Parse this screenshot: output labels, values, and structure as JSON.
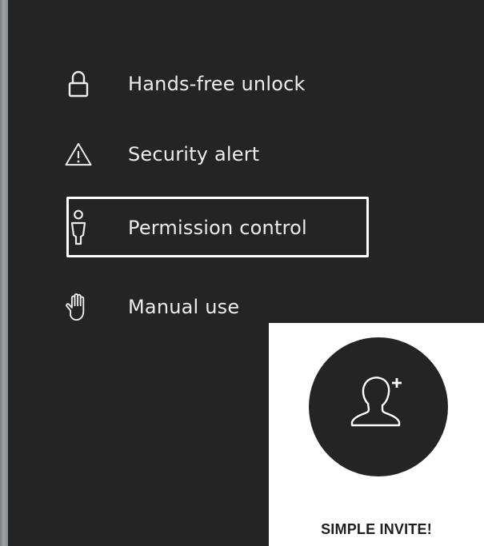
{
  "menu": {
    "items": [
      {
        "label": "Hands-free unlock",
        "icon": "lock-icon"
      },
      {
        "label": "Security alert",
        "icon": "warning-icon"
      },
      {
        "label": "Permission control",
        "icon": "person-key-icon",
        "selected": true
      },
      {
        "label": "Manual use",
        "icon": "hand-icon"
      }
    ]
  },
  "invite": {
    "label": "SIMPLE INVITE!",
    "icon": "add-user-icon"
  },
  "colors": {
    "panel_bg": "#242424",
    "text": "#ececec",
    "highlight_border": "#ffffff",
    "card_bg": "#ffffff",
    "circle_bg": "#242424"
  }
}
